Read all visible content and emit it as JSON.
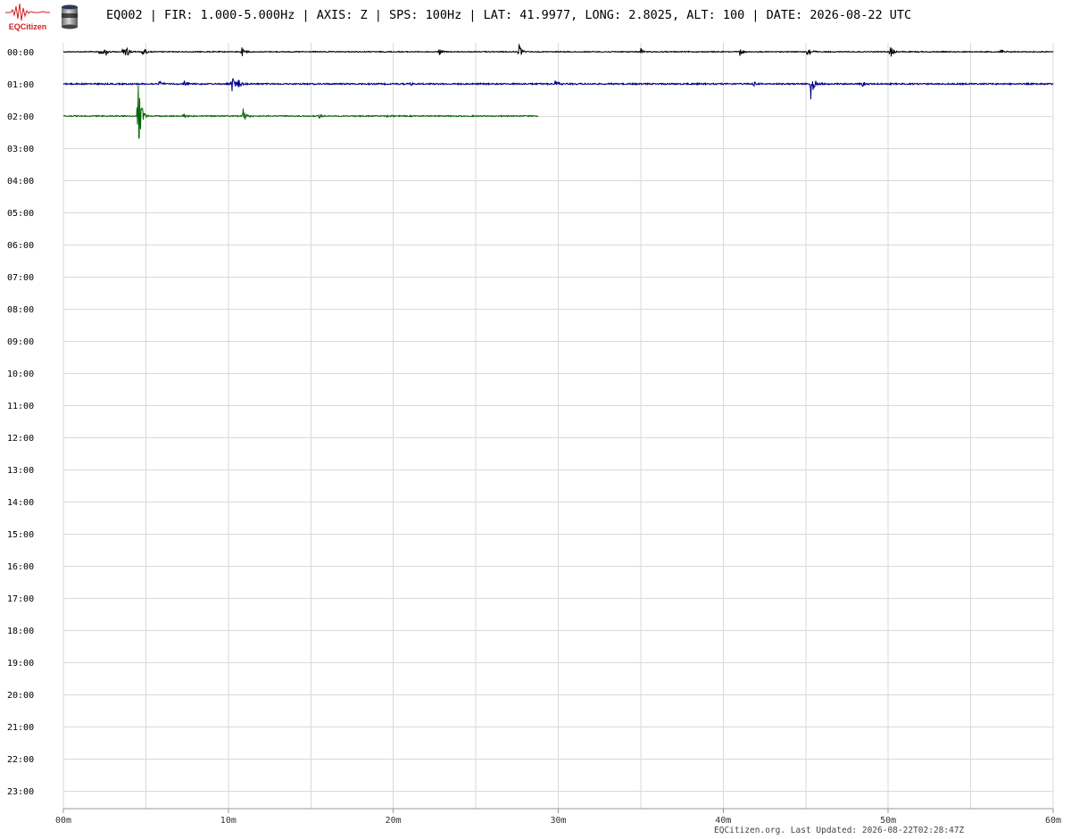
{
  "header": {
    "logo_text": "EQCitizen",
    "title": "EQ002 | FIR: 1.000-5.000Hz | AXIS: Z | SPS: 100Hz | LAT: 41.9977, LONG: 2.8025, ALT: 100 | DATE: 2026-08-22 UTC"
  },
  "footer": {
    "text": "EQCitizen.org. Last Updated: 2026-08-22T02:28:47Z"
  },
  "colors": {
    "grid": "#d9d9d9",
    "axis": "#999999",
    "logo_red": "#cc2222",
    "trace_row_0": "#000000",
    "trace_row_1": "#00008b",
    "trace_row_2": "#006400"
  },
  "chart_data": {
    "type": "line",
    "rows": [
      "00:00",
      "01:00",
      "02:00",
      "03:00",
      "04:00",
      "05:00",
      "06:00",
      "07:00",
      "08:00",
      "09:00",
      "10:00",
      "11:00",
      "12:00",
      "13:00",
      "14:00",
      "15:00",
      "16:00",
      "17:00",
      "18:00",
      "19:00",
      "20:00",
      "21:00",
      "22:00",
      "23:00"
    ],
    "x_ticks": [
      "00m",
      "10m",
      "20m",
      "30m",
      "40m",
      "50m",
      "60m"
    ],
    "x_range_minutes": [
      0,
      60
    ],
    "grid_minor_every_minutes": 5,
    "series": [
      {
        "row": 0,
        "color": "#000000",
        "end_minute": 60,
        "noise": 0.5,
        "events": [
          {
            "minute": 2.2,
            "amp": 7
          },
          {
            "minute": 2.5,
            "amp": 6
          },
          {
            "minute": 3.6,
            "amp": 9
          },
          {
            "minute": 3.8,
            "amp": 7
          },
          {
            "minute": 4.8,
            "amp": 7
          },
          {
            "minute": 10.8,
            "amp": 6
          },
          {
            "minute": 22.8,
            "amp": 4
          },
          {
            "minute": 27.6,
            "amp": 9
          },
          {
            "minute": 35.0,
            "amp": 4
          },
          {
            "minute": 41.0,
            "amp": 5
          },
          {
            "minute": 45.1,
            "amp": 10
          },
          {
            "minute": 50.1,
            "amp": 9
          },
          {
            "minute": 56.8,
            "amp": 4
          }
        ]
      },
      {
        "row": 1,
        "color": "#00008b",
        "end_minute": 60,
        "noise": 0.8,
        "events": [
          {
            "minute": 5.8,
            "amp": 5
          },
          {
            "minute": 7.3,
            "amp": 5
          },
          {
            "minute": 10.2,
            "amp": 12
          },
          {
            "minute": 10.6,
            "amp": 7
          },
          {
            "minute": 21.0,
            "amp": 3
          },
          {
            "minute": 29.8,
            "amp": 4
          },
          {
            "minute": 41.8,
            "amp": 4
          },
          {
            "minute": 45.3,
            "amp": 20
          },
          {
            "minute": 48.4,
            "amp": 5
          }
        ]
      },
      {
        "row": 2,
        "color": "#006400",
        "end_minute": 28.8,
        "noise": 0.6,
        "events": [
          {
            "minute": 4.5,
            "amp": 46
          },
          {
            "minute": 7.3,
            "amp": 3
          },
          {
            "minute": 10.9,
            "amp": 9
          },
          {
            "minute": 15.5,
            "amp": 3
          },
          {
            "minute": 19.5,
            "amp": 3
          }
        ]
      }
    ]
  }
}
